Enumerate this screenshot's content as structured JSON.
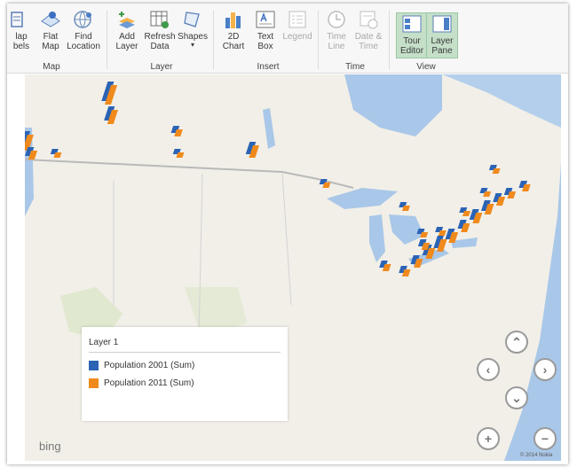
{
  "ribbon": {
    "map_group": {
      "label": "Map",
      "buttons": [
        {
          "line1": "lap",
          "line2": "bels",
          "icon": "map-labels-icon"
        },
        {
          "line1": "Flat",
          "line2": "Map",
          "icon": "flat-map-icon"
        },
        {
          "line1": "Find",
          "line2": "Location",
          "icon": "globe-icon"
        }
      ]
    },
    "layer_group": {
      "label": "Layer",
      "buttons": [
        {
          "line1": "Add",
          "line2": "Layer",
          "icon": "add-layer-icon"
        },
        {
          "line1": "Refresh",
          "line2": "Data",
          "icon": "refresh-data-icon"
        },
        {
          "line1": "Shapes",
          "line2": "▾",
          "icon": "shapes-icon"
        }
      ]
    },
    "insert_group": {
      "label": "Insert",
      "buttons": [
        {
          "line1": "2D",
          "line2": "Chart",
          "icon": "bar-chart-icon"
        },
        {
          "line1": "Text",
          "line2": "Box",
          "icon": "text-box-icon"
        },
        {
          "line1": "Legend",
          "line2": "",
          "icon": "legend-icon",
          "disabled": true
        }
      ]
    },
    "time_group": {
      "label": "Time",
      "buttons": [
        {
          "line1": "Time",
          "line2": "Line",
          "icon": "clock-icon",
          "disabled": true
        },
        {
          "line1": "Date &",
          "line2": "Time",
          "icon": "date-time-icon",
          "disabled": true
        }
      ]
    },
    "view_group": {
      "label": "View",
      "buttons": [
        {
          "line1": "Tour",
          "line2": "Editor",
          "icon": "tour-editor-icon",
          "active": true
        },
        {
          "line1": "Layer",
          "line2": "Pane",
          "icon": "layer-pane-icon",
          "active": true
        }
      ]
    }
  },
  "legend": {
    "title": "Layer 1",
    "items": [
      {
        "label": "Population 2001 (Sum)",
        "color": "#2b63b5"
      },
      {
        "label": "Population 2011 (Sum)",
        "color": "#f08a1c"
      }
    ]
  },
  "nav": {
    "up": "⌃",
    "left": "‹",
    "right": "›",
    "down": "⌄",
    "zoom_in": "+",
    "zoom_out": "−"
  },
  "map_footer": {
    "logo": "bing",
    "copyright": "© 2014 Nokia"
  },
  "colors": {
    "water": "#a9c7e8",
    "land": "#f1efe8",
    "series_2001": "#2b63b5",
    "series_2011": "#f08a1c"
  }
}
